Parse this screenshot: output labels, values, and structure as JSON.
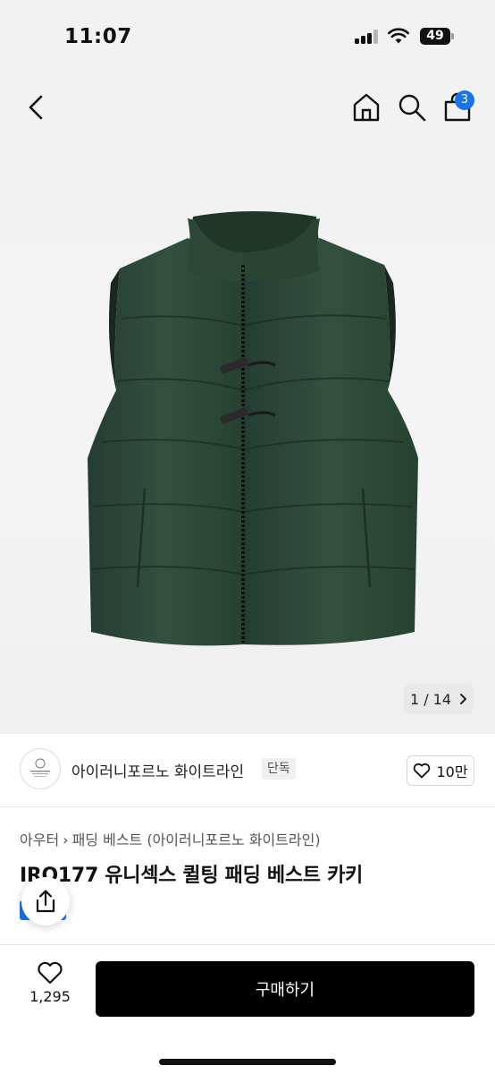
{
  "status_bar": {
    "time": "11:07",
    "battery": "49"
  },
  "nav": {
    "cart_count": "3"
  },
  "gallery": {
    "page_current": "1",
    "page_total": "14",
    "page_label": "1 / 14"
  },
  "brand": {
    "name": "아이러니포르노 화이트라인",
    "badge": "단독",
    "likes": "10만"
  },
  "breadcrumb": {
    "category": "아우터",
    "subcategory": "패딩 베스트 (아이러니포르노 화이트라인)"
  },
  "product": {
    "title": "IRO177 유니섹스 퀼팅 패딩 베스트 카키"
  },
  "bottom": {
    "favorite_count": "1,295",
    "buy_label": "구매하기"
  },
  "colors": {
    "accent": "#1a73e8",
    "buy_button": "#000000",
    "vest": "#2e4a3e"
  },
  "icons": [
    "back-icon",
    "home-icon",
    "search-icon",
    "cart-icon",
    "chevron-right-icon",
    "heart-icon",
    "share-icon"
  ]
}
